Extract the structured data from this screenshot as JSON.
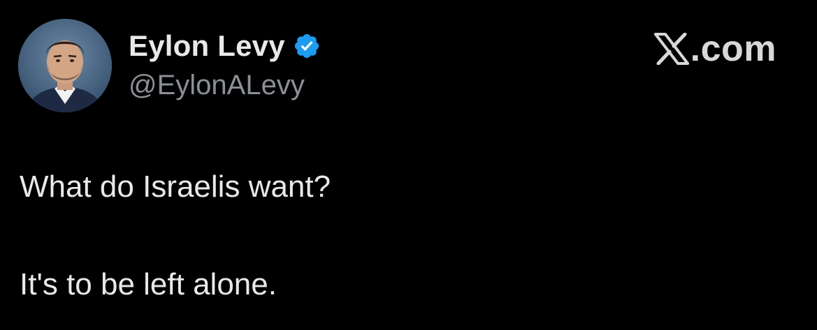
{
  "author": {
    "display_name": "Eylon Levy",
    "handle": "@EylonALevy",
    "verified": true,
    "avatar": "profile-photo"
  },
  "brand": {
    "logo_icon": "x-logo-icon",
    "text": ".com"
  },
  "tweet": {
    "lines": [
      "What do Israelis want?",
      "It's to be left alone."
    ]
  },
  "colors": {
    "background": "#000000",
    "primary_text": "#e7e9ea",
    "secondary_text": "#8b9096",
    "verified_badge": "#1d9bf0"
  }
}
